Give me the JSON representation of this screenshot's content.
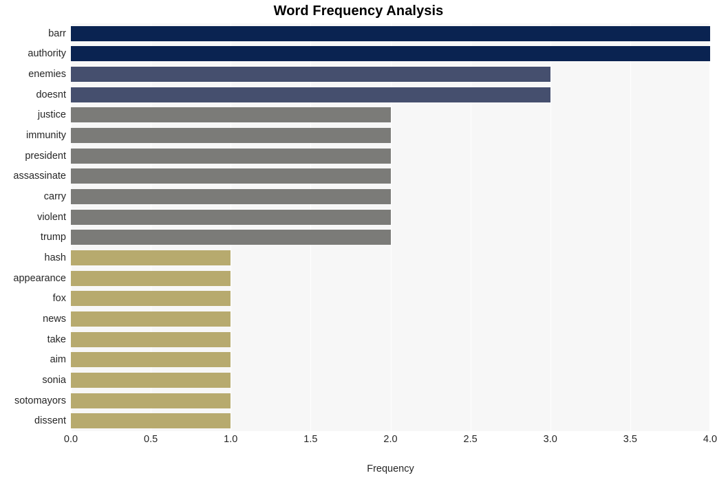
{
  "chart_data": {
    "type": "bar",
    "orientation": "horizontal",
    "title": "Word Frequency Analysis",
    "xlabel": "Frequency",
    "ylabel": "",
    "xlim": [
      0,
      4
    ],
    "xticks": [
      "0.0",
      "0.5",
      "1.0",
      "1.5",
      "2.0",
      "2.5",
      "3.0",
      "3.5",
      "4.0"
    ],
    "xtick_values": [
      0,
      0.5,
      1,
      1.5,
      2,
      2.5,
      3,
      3.5,
      4
    ],
    "grid": "vertical-white",
    "legend": "none",
    "categories": [
      "barr",
      "authority",
      "enemies",
      "doesnt",
      "justice",
      "immunity",
      "president",
      "assassinate",
      "carry",
      "violent",
      "trump",
      "hash",
      "appearance",
      "fox",
      "news",
      "take",
      "aim",
      "sonia",
      "sotomayors",
      "dissent"
    ],
    "values": [
      4,
      4,
      3,
      3,
      2,
      2,
      2,
      2,
      2,
      2,
      2,
      1,
      1,
      1,
      1,
      1,
      1,
      1,
      1,
      1
    ],
    "bar_colors": [
      "#0a2351",
      "#0a2351",
      "#454f6e",
      "#454f6e",
      "#7b7b78",
      "#7b7b78",
      "#7b7b78",
      "#7b7b78",
      "#7b7b78",
      "#7b7b78",
      "#7b7b78",
      "#b7aa6e",
      "#b7aa6e",
      "#b7aa6e",
      "#b7aa6e",
      "#b7aa6e",
      "#b7aa6e",
      "#b7aa6e",
      "#b7aa6e",
      "#b7aa6e"
    ]
  },
  "style": {
    "plot_background": "#f7f7f7",
    "figure_background": "#ffffff",
    "gridline_color": "#ffffff",
    "text_color": "#262626",
    "title_color": "#000000"
  }
}
